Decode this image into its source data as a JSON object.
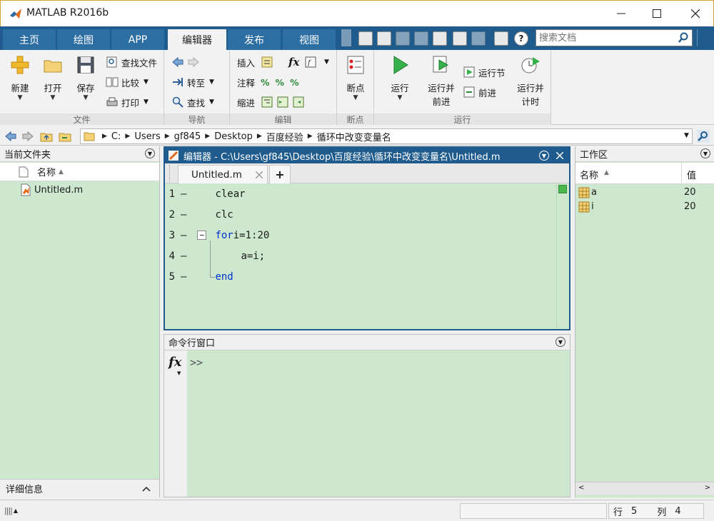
{
  "window": {
    "title": "MATLAB R2016b"
  },
  "ribbon_tabs": [
    {
      "label": "主页"
    },
    {
      "label": "绘图"
    },
    {
      "label": "APP"
    },
    {
      "label": "编辑器"
    },
    {
      "label": "发布"
    },
    {
      "label": "视图"
    }
  ],
  "search": {
    "placeholder": "搜索文档"
  },
  "ribbon": {
    "file": {
      "label": "文件",
      "new": "新建",
      "open": "打开",
      "save": "保存",
      "find_files": "查找文件",
      "compare": "比较",
      "print": "打印"
    },
    "navigate": {
      "label": "导航",
      "goto": "转至",
      "find": "查找"
    },
    "edit": {
      "label": "编辑",
      "insert": "插入",
      "comment": "注释",
      "indent": "缩进",
      "fx": "fx"
    },
    "breakpoints": {
      "label": "断点",
      "breakpoints": "断点"
    },
    "run": {
      "label": "运行",
      "run": "运行",
      "run_advance_1": "运行并",
      "run_advance_2": "前进",
      "run_section": "运行节",
      "advance": "前进",
      "run_time_1": "运行并",
      "run_time_2": "计时"
    }
  },
  "address": {
    "crumbs": [
      "C:",
      "Users",
      "gf845",
      "Desktop",
      "百度经验",
      "循环中改变变量名"
    ]
  },
  "current_folder": {
    "title": "当前文件夹",
    "column_name": "名称",
    "files": [
      "Untitled.m"
    ],
    "details": "详细信息"
  },
  "editor": {
    "title": "编辑器 - C:\\Users\\gf845\\Desktop\\百度经验\\循环中改变变量名\\Untitled.m",
    "tab_label": "Untitled.m",
    "add_tab": "+",
    "lines": [
      {
        "num": "1",
        "text": "clear",
        "kw": ""
      },
      {
        "num": "2",
        "text": "clc",
        "kw": ""
      },
      {
        "num": "3",
        "text": " i=1:20",
        "kw": "for"
      },
      {
        "num": "4",
        "text": "a=i;",
        "kw": ""
      },
      {
        "num": "5",
        "text": "",
        "kw": "end"
      }
    ]
  },
  "command_window": {
    "title": "命令行窗口",
    "fx": "fx",
    "prompt": ">>"
  },
  "workspace": {
    "title": "工作区",
    "col_name": "名称",
    "col_value": "值",
    "vars": [
      {
        "name": "a",
        "value": "20"
      },
      {
        "name": "i",
        "value": "20"
      }
    ]
  },
  "status": {
    "row_label": "行",
    "row_value": "5",
    "col_label": "列",
    "col_value": "4"
  },
  "colors": {
    "tab_bar": "#1f5c8d",
    "panel_green": "#cde8cf",
    "keyword": "#0033cc"
  }
}
